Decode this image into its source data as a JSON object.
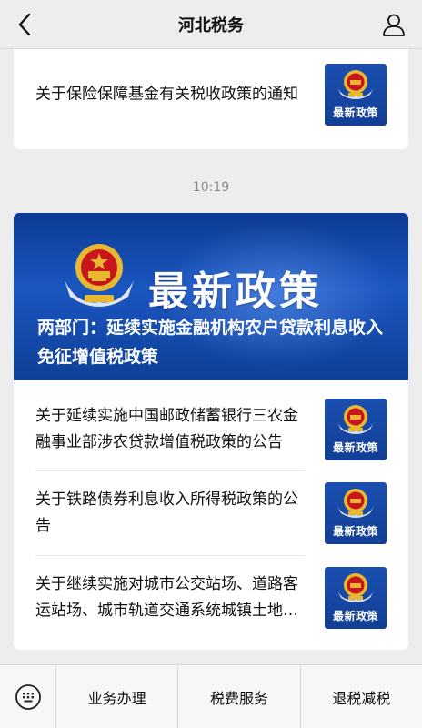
{
  "header": {
    "title": "河北税务",
    "back_icon": "chevron-left-icon",
    "profile_icon": "user-icon"
  },
  "previous_card": {
    "title": "关于保险保障基金有关税收政策的通知",
    "thumb_label": "最新政策"
  },
  "timestamp": "10:19",
  "main_card": {
    "banner_title": "最新政策",
    "banner_caption": "两部门：延续实施金融机构农户贷款利息收入免征增值税政策",
    "items": [
      {
        "title": "关于延续实施中国邮政储蓄银行三农金融事业部涉农贷款增值税政策的公告",
        "thumb_label": "最新政策"
      },
      {
        "title": "关于铁路债券利息收入所得税政策的公告",
        "thumb_label": "最新政策"
      },
      {
        "title": "关于继续实施对城市公交站场、道路客运站场、城市轨道交通系统城镇土地使用税优惠政策的公告",
        "thumb_label": "最新政策"
      }
    ]
  },
  "tabbar": {
    "keyboard_icon": "keyboard-icon",
    "tabs": [
      {
        "label": "业务办理"
      },
      {
        "label": "税费服务"
      },
      {
        "label": "退税减税"
      }
    ]
  },
  "colors": {
    "background": "#ededed",
    "banner_blue": "#1a4fb0",
    "emblem_red": "#c8161d",
    "emblem_gold": "#e8b830"
  }
}
